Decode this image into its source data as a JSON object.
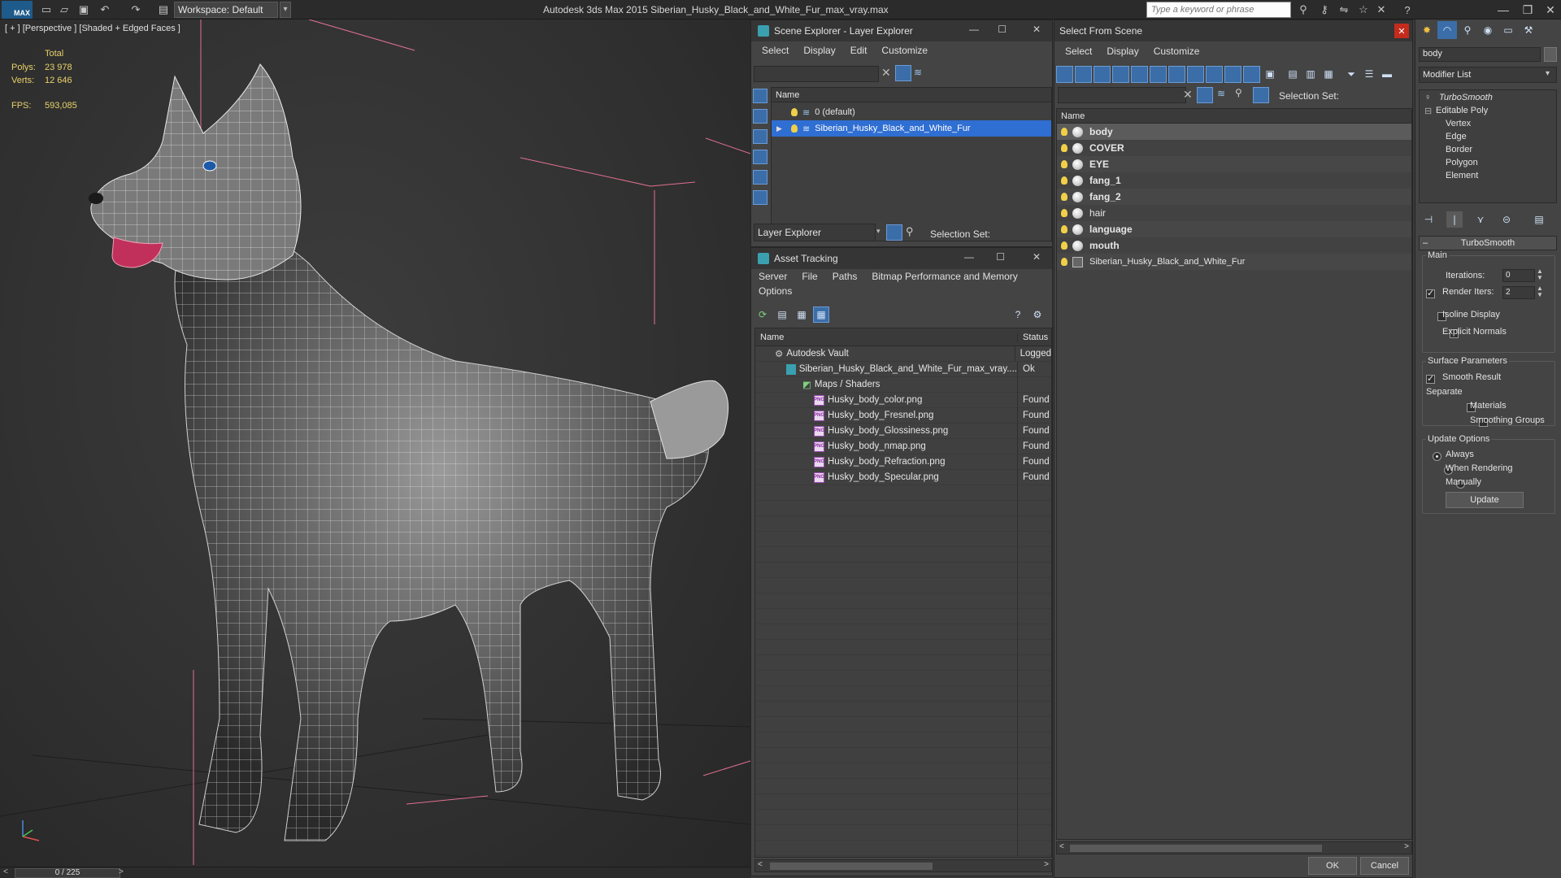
{
  "app": {
    "logo": "MAX",
    "workspace": "Workspace: Default",
    "title": "Autodesk 3ds Max  2015    Siberian_Husky_Black_and_White_Fur_max_vray.max",
    "search_placeholder": "Type a keyword or phrase"
  },
  "viewport": {
    "label": "[ + ] [Perspective ] [Shaded + Edged Faces ]",
    "stats_header": "Total",
    "polys_label": "Polys:",
    "polys_value": "23 978",
    "verts_label": "Verts:",
    "verts_value": "12 646",
    "fps_label": "FPS:",
    "fps_value": "593,085"
  },
  "timeline": {
    "frame": "0 / 225",
    "prev": "<",
    "next": ">"
  },
  "scene_explorer": {
    "title": "Scene Explorer - Layer Explorer",
    "menu": [
      "Select",
      "Display",
      "Edit",
      "Customize"
    ],
    "col_name": "Name",
    "layers": [
      {
        "label": "0 (default)"
      },
      {
        "label": "Siberian_Husky_Black_and_White_Fur"
      }
    ],
    "footer_dropdown": "Layer Explorer",
    "footer_selection_set": "Selection Set:"
  },
  "asset_tracking": {
    "title": "Asset Tracking",
    "menu1": [
      "Server",
      "File",
      "Paths",
      "Bitmap Performance and Memory"
    ],
    "menu2": [
      "Options"
    ],
    "col_name": "Name",
    "col_status": "Status",
    "rows": [
      {
        "name": "Autodesk Vault",
        "status": "Logged"
      },
      {
        "name": "Siberian_Husky_Black_and_White_Fur_max_vray....",
        "status": "Ok"
      },
      {
        "name": "Maps / Shaders",
        "status": ""
      },
      {
        "name": "Husky_body_color.png",
        "status": "Found"
      },
      {
        "name": "Husky_body_Fresnel.png",
        "status": "Found"
      },
      {
        "name": "Husky_body_Glossiness.png",
        "status": "Found"
      },
      {
        "name": "Husky_body_nmap.png",
        "status": "Found"
      },
      {
        "name": "Husky_body_Refraction.png",
        "status": "Found"
      },
      {
        "name": "Husky_body_Specular.png",
        "status": "Found"
      }
    ]
  },
  "select_from_scene": {
    "title": "Select From Scene",
    "menu": [
      "Select",
      "Display",
      "Customize"
    ],
    "selection_set": "Selection Set:",
    "col_name": "Name",
    "items": [
      {
        "label": "body"
      },
      {
        "label": "COVER"
      },
      {
        "label": "EYE"
      },
      {
        "label": "fang_1"
      },
      {
        "label": "fang_2"
      },
      {
        "label": "hair"
      },
      {
        "label": "language"
      },
      {
        "label": "mouth"
      },
      {
        "label": "Siberian_Husky_Black_and_White_Fur"
      }
    ],
    "ok": "OK",
    "cancel": "Cancel"
  },
  "command_panel": {
    "object_name": "body",
    "modifier_list": "Modifier List",
    "stack": [
      "TurboSmooth",
      "Editable Poly",
      "Vertex",
      "Edge",
      "Border",
      "Polygon",
      "Element"
    ],
    "rollout_title": "TurboSmooth",
    "main_label": "Main",
    "iterations_label": "Iterations:",
    "iterations_value": "0",
    "render_iters_label": "Render Iters:",
    "render_iters_value": "2",
    "isoline_label": "Isoline Display",
    "explicit_normals_label": "Explicit Normals",
    "surface_params_label": "Surface Parameters",
    "smooth_result_label": "Smooth Result",
    "separate_label": "Separate",
    "materials_label": "Materials",
    "smoothing_groups_label": "Smoothing Groups",
    "update_options_label": "Update Options",
    "always_label": "Always",
    "when_rendering_label": "When Rendering",
    "manually_label": "Manually",
    "update_button": "Update"
  }
}
